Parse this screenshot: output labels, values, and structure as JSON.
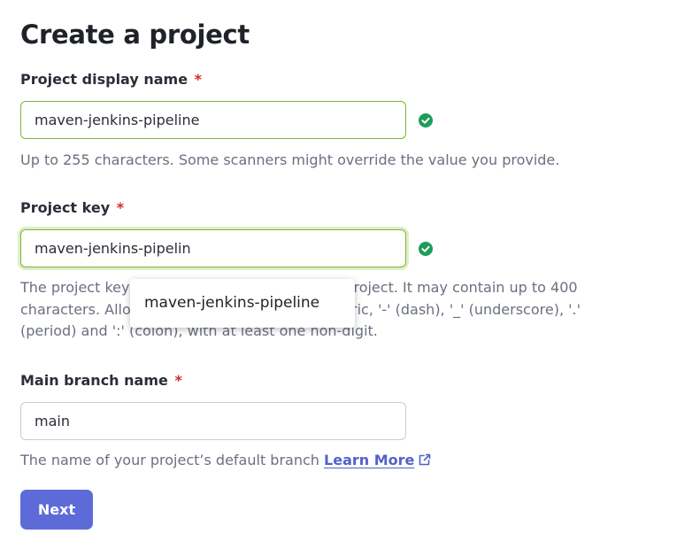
{
  "page": {
    "title": "Create a project"
  },
  "fields": {
    "display_name": {
      "label": "Project display name",
      "required_mark": "*",
      "value": "maven-jenkins-pipeline",
      "help": "Up to 255 characters. Some scanners might override the value you provide."
    },
    "project_key": {
      "label": "Project key",
      "required_mark": "*",
      "value": "maven-jenkins-pipelin",
      "help": "The project key is a unique identifier for your project. It may contain up to 400 characters. Allowed characters are alphanumeric, '-' (dash), '_' (underscore), '.' (period) and ':' (colon), with at least one non-digit."
    },
    "main_branch": {
      "label": "Main branch name",
      "required_mark": "*",
      "value": "main",
      "help": "The name of your project’s default branch",
      "learn_more": "Learn More"
    }
  },
  "autocomplete": {
    "suggestion": "maven-jenkins-pipeline"
  },
  "actions": {
    "next_label": "Next"
  },
  "colors": {
    "accent": "#5d6bd8",
    "valid_border": "#7fb43a",
    "valid_icon": "#1e9c5a",
    "required": "#d02b2b",
    "link": "#5262c9"
  },
  "icons": {
    "valid": "check-circle-icon",
    "external": "external-link-icon"
  }
}
